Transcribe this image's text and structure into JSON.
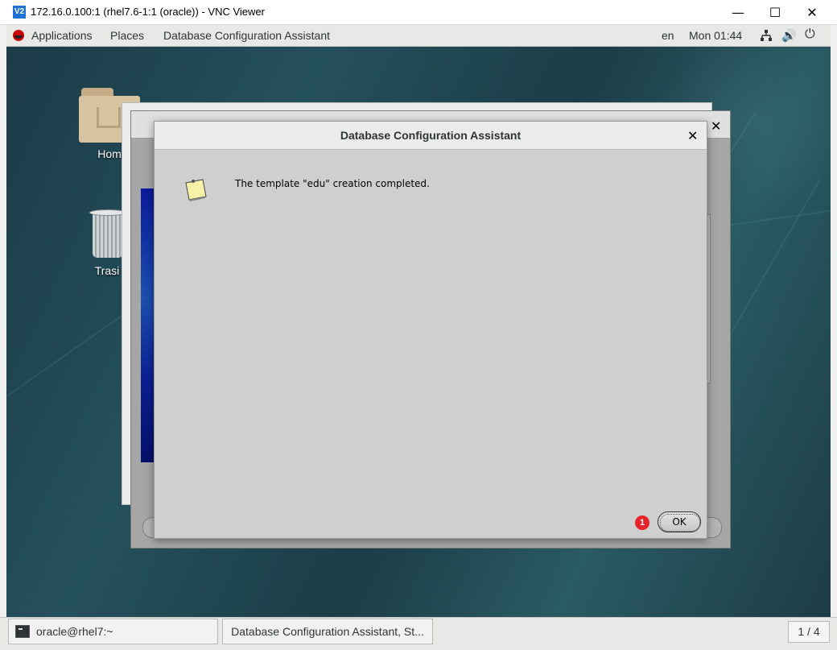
{
  "vnc": {
    "logo_text": "V2",
    "title": "172.16.0.100:1 (rhel7.6-1:1 (oracle)) - VNC Viewer",
    "minimize": "—",
    "maximize": "☐",
    "close": "✕"
  },
  "gnome_bar": {
    "applications": "Applications",
    "places": "Places",
    "active_app": "Database Configuration Assistant",
    "language": "en",
    "clock": "Mon 01:44",
    "icons": [
      "network-icon",
      "volume-icon",
      "power-icon"
    ]
  },
  "desktop": {
    "home_label": "Hom",
    "trash_label": "Trasi"
  },
  "background_window": {
    "close": "✕"
  },
  "dialog": {
    "title": "Database Configuration Assistant",
    "close": "✕",
    "message": "The template \"edu\" creation completed.",
    "ok_label": "OK",
    "step_badge": "1"
  },
  "taskbar": {
    "terminal_task": "oracle@rhel7:~",
    "dbca_task": "Database Configuration Assistant, St...",
    "workspace": "1 / 4"
  },
  "colors": {
    "badge": "#e8242a",
    "vnc_logo": "#1e73d1",
    "banner": "#0b1f92"
  }
}
